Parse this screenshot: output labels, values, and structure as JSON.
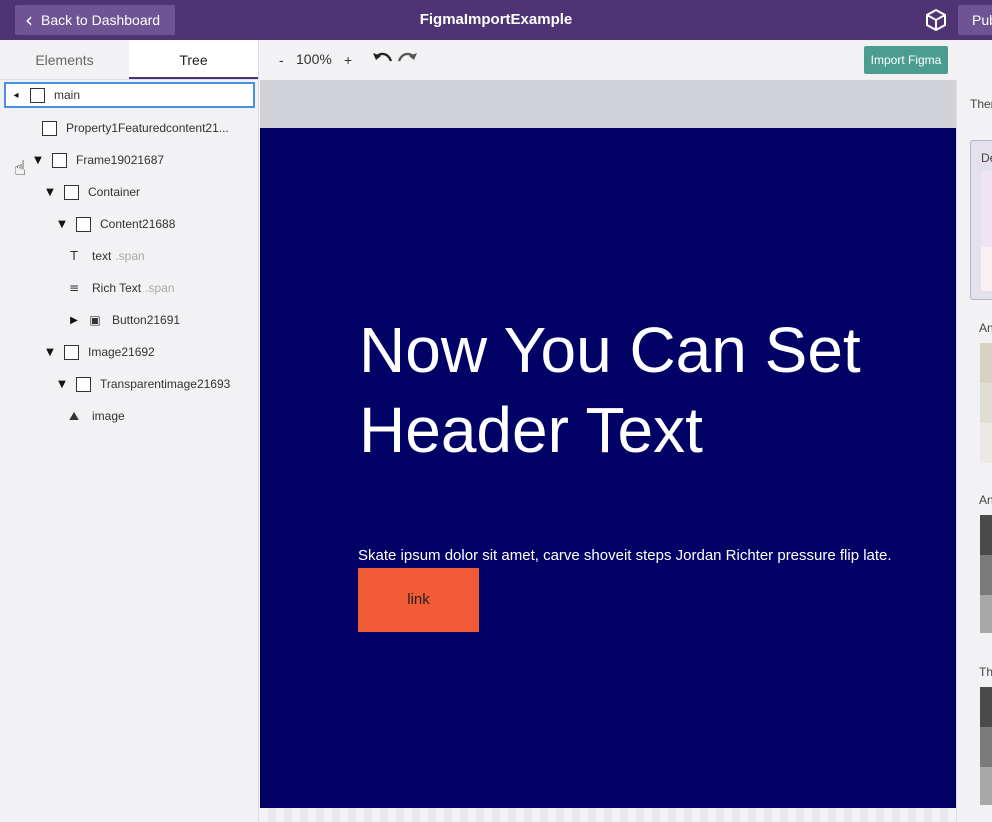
{
  "header": {
    "back_label": "Back to Dashboard",
    "title": "FigmaImportExample",
    "publish_label": "Pub"
  },
  "left_panel": {
    "tabs": [
      {
        "label": "Elements",
        "active": false
      },
      {
        "label": "Tree",
        "active": true
      }
    ],
    "tree": [
      {
        "label": "main",
        "icon": "box",
        "expander": "collapse",
        "sub": ""
      },
      {
        "label": "Property1Featuredcontent21...",
        "icon": "box",
        "expander": "none",
        "sub": ""
      },
      {
        "label": "Frame19021687",
        "icon": "box",
        "expander": "expanded",
        "sub": ""
      },
      {
        "label": "Container",
        "icon": "box",
        "expander": "expanded",
        "sub": ""
      },
      {
        "label": "Content21688",
        "icon": "box",
        "expander": "expanded",
        "sub": ""
      },
      {
        "label": "text",
        "icon": "text-icon",
        "expander": "none",
        "sub": ".span"
      },
      {
        "label": "Rich Text",
        "icon": "richtext-icon",
        "expander": "none",
        "sub": ".span"
      },
      {
        "label": "Button21691",
        "icon": "button-icon",
        "expander": "collapsed",
        "sub": ""
      },
      {
        "label": "Image21692",
        "icon": "box",
        "expander": "expanded",
        "sub": ""
      },
      {
        "label": "Transparentimage21693",
        "icon": "box",
        "expander": "expanded",
        "sub": ""
      },
      {
        "label": "image",
        "icon": "image-icon",
        "expander": "none",
        "sub": ""
      }
    ]
  },
  "toolbar": {
    "zoom_minus": "-",
    "zoom_level": "100%",
    "zoom_plus": "+",
    "import_label": "Import Figma"
  },
  "canvas": {
    "hero_title": "Now You Can Set Header Text",
    "hero_body": "Skate ipsum dolor sit amet, carve shoveit steps Jordan Richter pressure flip late.",
    "link_label": "link",
    "hero_bg": "#020266",
    "link_bg": "#f05a35"
  },
  "right_panel": {
    "theme_label": "Ther",
    "card_label": "De",
    "section_a": "An",
    "section_b": "An",
    "section_c": "Th"
  },
  "colors": {
    "topbar": "#4f3475",
    "accent_button": "#4a9d8f"
  }
}
